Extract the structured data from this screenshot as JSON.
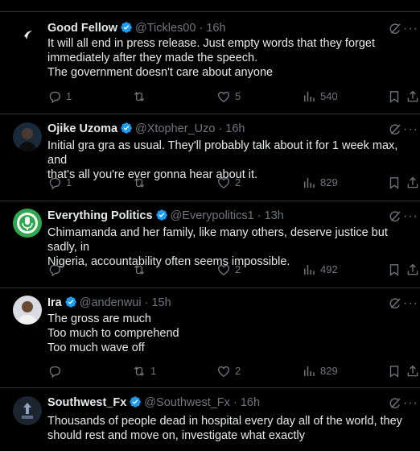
{
  "tweets": [
    {
      "name": "Good Fellow",
      "handle": "@Tickles00",
      "sep": "·",
      "time": "16h",
      "lines": [
        "It will all end in press release. Just empty words that they forget",
        "immediately after they made the speech.",
        "The government doesn't care about anyone"
      ],
      "replies": "1",
      "reposts": "",
      "likes": "5",
      "views": "540",
      "avatar_color": "#000000"
    },
    {
      "name": "Ojike Uzoma",
      "handle": "@Xtopher_Uzo",
      "sep": "·",
      "time": "16h",
      "lines": [
        "Initial gra gra as usual. They'll probably talk about it for 1 week max, and",
        "that's all you're ever gonna hear about it."
      ],
      "replies": "1",
      "reposts": "",
      "likes": "2",
      "views": "829",
      "avatar_color": "#1b2a3a"
    },
    {
      "name": "Everything Politics",
      "handle": "@Everypolitics1",
      "sep": "·",
      "time": "13h",
      "lines": [
        "Chimamanda and her family, like many others, deserve justice but sadly, in",
        "Nigeria, accountability often seems impossible."
      ],
      "replies": "",
      "reposts": "",
      "likes": "2",
      "views": "492",
      "avatar_color": "#2fa84f"
    },
    {
      "name": "Ira",
      "handle": "@andenwui",
      "sep": "·",
      "time": "15h",
      "lines": [
        "The gross are much",
        "Too much to comprehend",
        "Too much wave off"
      ],
      "replies": "",
      "reposts": "1",
      "likes": "2",
      "views": "829",
      "avatar_color": "#d9dde3"
    },
    {
      "name": "Southwest_Fx",
      "handle": "@Southwest_Fx",
      "sep": "·",
      "time": "16h",
      "lines": [
        "Thousands of people dead in hospital every day all of the world, they",
        "should rest and move on, investigate what exactly"
      ],
      "replies": "",
      "reposts": "",
      "likes": "",
      "views": "",
      "avatar_color": "#1c2430"
    }
  ],
  "colors": {
    "accent": "#1d9bf0",
    "muted": "#71767b",
    "text": "#e7e9ea",
    "divider": "#2f3336"
  },
  "more_label": "···"
}
